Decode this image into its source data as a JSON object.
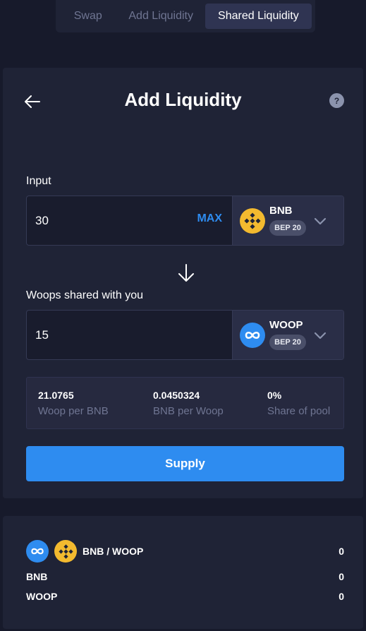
{
  "tabs": [
    "Swap",
    "Add Liquidity",
    "Shared Liquidity"
  ],
  "active_tab": "Shared Liquidity",
  "page_title": "Add Liquidity",
  "help_glyph": "?",
  "input_section": {
    "label": "Input",
    "value": "30",
    "max_label": "MAX",
    "token": {
      "symbol": "BNB",
      "badge": "BEP 20",
      "icon": "bnb-icon"
    }
  },
  "shared_section": {
    "label": "Woops shared with you",
    "value": "15",
    "token": {
      "symbol": "WOOP",
      "badge": "BEP 20",
      "icon": "woop-icon"
    }
  },
  "stats": [
    {
      "value": "21.0765",
      "label": "Woop per BNB"
    },
    {
      "value": "0.0450324",
      "label": "BNB per Woop"
    },
    {
      "value": "0%",
      "label": "Share of pool"
    }
  ],
  "supply_label": "Supply",
  "position": {
    "pair": "BNB / WOOP",
    "pair_value": "0",
    "rows": [
      {
        "label": "BNB",
        "value": "0"
      },
      {
        "label": "WOOP",
        "value": "0"
      }
    ]
  },
  "colors": {
    "accent": "#2e8cf0",
    "bnb": "#f3ba2f",
    "woop": "#2e8cf0"
  }
}
